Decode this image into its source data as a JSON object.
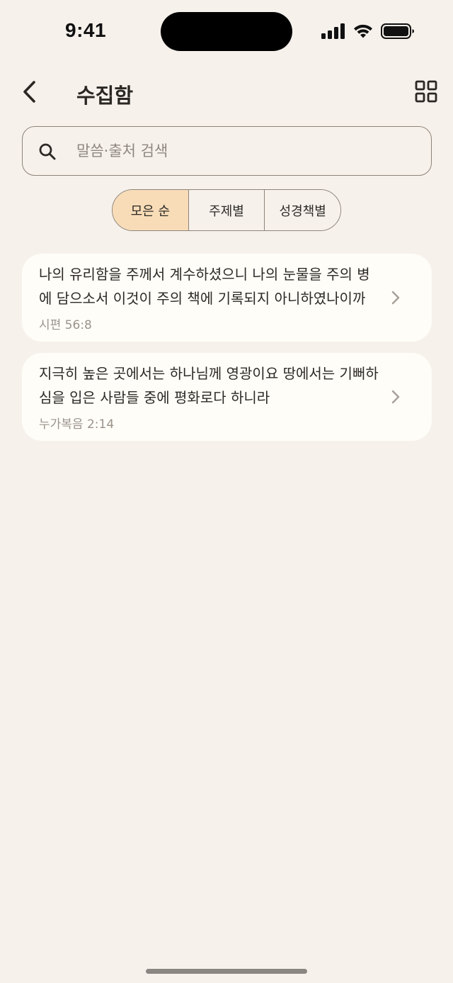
{
  "status_bar": {
    "time": "9:41"
  },
  "header": {
    "title": "수집함"
  },
  "search": {
    "placeholder": "말씀·출처 검색"
  },
  "sort_tabs": [
    {
      "label": "모은 순",
      "selected": true
    },
    {
      "label": "주제별",
      "selected": false
    },
    {
      "label": "성경책별",
      "selected": false
    }
  ],
  "verses": [
    {
      "text": "나의 유리함을 주께서 계수하셨으니 나의 눈물을 주의 병에 담으소서 이것이 주의 책에 기록되지 아니하였나이까",
      "reference": "시편 56:8"
    },
    {
      "text": "지극히 높은 곳에서는 하나님께 영광이요 땅에서는 기뻐하심을 입은 사람들 중에 평화로다 하니라",
      "reference": "누가복음 2:14"
    }
  ],
  "colors": {
    "background": "#f6f1eb",
    "card": "#fffdf8",
    "selected_tab": "#f8dcb8",
    "border": "#8e8479",
    "secondary_text": "#9a938b"
  }
}
